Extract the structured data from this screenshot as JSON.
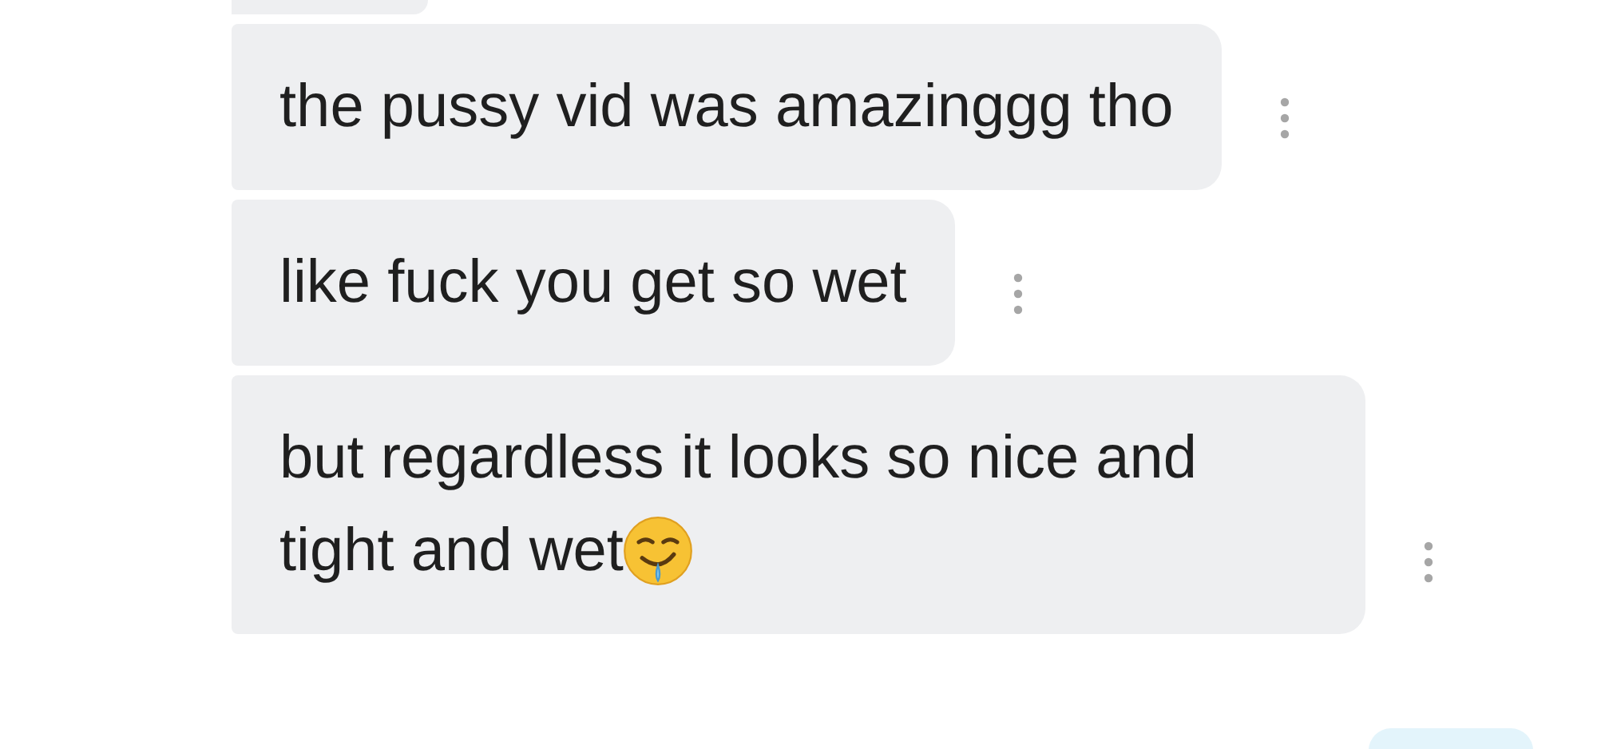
{
  "messages": [
    {
      "text": "the pussy vid was amazinggg tho",
      "emoji": false
    },
    {
      "text": "like fuck you get so wet",
      "emoji": false
    },
    {
      "text": "but regardless it looks so nice and tight and wet",
      "emoji": true
    }
  ]
}
